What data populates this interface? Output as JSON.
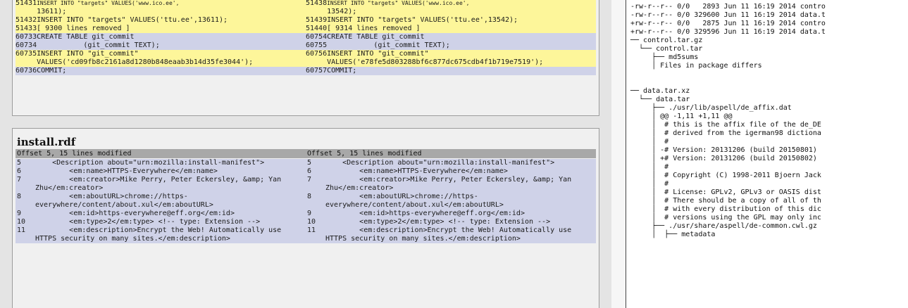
{
  "top_diff": {
    "rows": [
      {
        "bg": "add",
        "left": {
          "ln": "51431",
          "code": "13611);",
          "pre": "INSERT INTO \"targets\" VALUES('www.ico.ee',"
        },
        "right": {
          "ln": "51438",
          "code": "13542);",
          "pre": "INSERT INTO \"targets\" VALUES('www.ico.ee',"
        }
      },
      {
        "bg": "add",
        "left": {
          "ln": "51432",
          "code": "INSERT INTO \"targets\" VALUES('ttu.ee',13611);"
        },
        "right": {
          "ln": "51439",
          "code": "INSERT INTO \"targets\" VALUES('ttu.ee',13542);"
        }
      },
      {
        "bg": "add",
        "left": {
          "ln": "51433",
          "code": "[ 9300 lines removed ]"
        },
        "right": {
          "ln": "51440",
          "code": "[ 9314 lines removed ]"
        }
      },
      {
        "bg": "ctx",
        "left": {
          "ln": "60733",
          "code": "CREATE TABLE git_commit"
        },
        "right": {
          "ln": "60754",
          "code": "CREATE TABLE git_commit"
        }
      },
      {
        "bg": "ctx",
        "left": {
          "ln": "60734",
          "code": "           (git_commit TEXT);"
        },
        "right": {
          "ln": "60755",
          "code": "           (git_commit TEXT);"
        }
      },
      {
        "bg": "add",
        "left": {
          "ln": "60735",
          "code": "INSERT INTO \"git_commit\" VALUES('cd09fb8c2161a8d1280b848eaab3b14d35fe3044');"
        },
        "right": {
          "ln": "60756",
          "code": "INSERT INTO \"git_commit\" VALUES('e78fe5d803288bf6c877dc675cdb4f1b719e7519');"
        }
      },
      {
        "bg": "ctx",
        "left": {
          "ln": "60736",
          "code": "COMMIT;"
        },
        "right": {
          "ln": "60757",
          "code": "COMMIT;"
        }
      }
    ]
  },
  "bottom_diff": {
    "filename": "install.rdf",
    "hunk_left": "Offset 5, 15 lines modified",
    "hunk_right": "Offset 5, 15 lines modified",
    "rows": [
      {
        "ln": "5",
        "code": "    <Description about=\"urn:mozilla:install-manifest\">"
      },
      {
        "ln": "6",
        "code": "        <em:name>HTTPS-Everywhere</em:name>"
      },
      {
        "ln": "7",
        "code": "        <em:creator>Mike Perry, Peter Eckersley, &amp; Yan Zhu</em:creator>"
      },
      {
        "ln": "8",
        "code": "        <em:aboutURL>chrome://https-everywhere/content/about.xul</em:aboutURL>"
      },
      {
        "ln": "9",
        "code": "        <em:id>https-everywhere@eff.org</em:id>"
      },
      {
        "ln": "10",
        "code": "        <em:type>2</em:type> <!-- type: Extension -->"
      },
      {
        "ln": "11",
        "code": "        <em:description>Encrypt the Web! Automatically use HTTPS security on many sites.</em:description>"
      }
    ]
  },
  "tree": {
    "lines": [
      "-rw-r--r-- 0/0   2893 Jun 11 16:19 2014 contro",
      "-rw-r--r-- 0/0 329600 Jun 11 16:19 2014 data.t",
      "+rw-r--r-- 0/0   2875 Jun 11 16:19 2014 contro",
      "+rw-r--r-- 0/0 329596 Jun 11 16:19 2014 data.t",
      "── control.tar.gz",
      "  └── control.tar",
      "     ├── md5sums",
      "     │ Files in package differs",
      "",
      "",
      "── data.tar.xz",
      "  └── data.tar",
      "     ├── ./usr/lib/aspell/de_affix.dat",
      "     │ @@ -1,11 +1,11 @@",
      "     │  # this is the affix file of the de_DE",
      "     │  # derived from the igerman98 dictiona",
      "     │  #",
      "     │ -# Version: 20131206 (build 20150801)",
      "     │ +# Version: 20131206 (build 20150802)",
      "     │  #",
      "     │  # Copyright (C) 1998-2011 Bjoern Jack",
      "     │  #",
      "     │  # License: GPLv2, GPLv3 or OASIS dist",
      "     │  # There should be a copy of all of th",
      "     │  # with every distribution of this dic",
      "     │  # versions using the GPL may only inc",
      "     ├── ./usr/share/aspell/de-common.cwl.gz",
      "     │  ├── metadata"
    ]
  }
}
